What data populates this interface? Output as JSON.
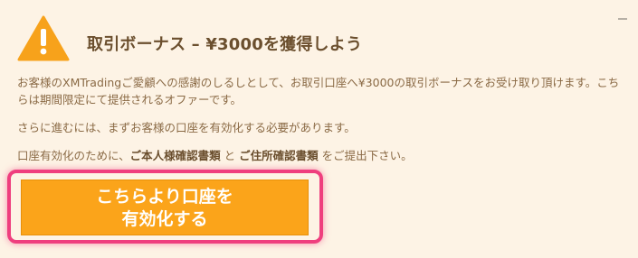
{
  "banner": {
    "title": "取引ボーナス – ¥3000を獲得しよう",
    "icon": "warning-triangle-icon",
    "paragraph1": "お客様のXMTradingご愛顧への感謝のしるしとして、お取引口座へ¥3000の取引ボーナスをお受け取り頂けます。こちらは期間限定にて提供されるオファーです。",
    "paragraph2": "さらに進むには、まずお客様の口座を有効化する必要があります。",
    "paragraph3_prefix": "口座有効化のために、",
    "paragraph3_doc1": "ご本人様確認書類",
    "paragraph3_and": " と ",
    "paragraph3_doc2": "ご住所確認書類",
    "paragraph3_suffix": " をご提出下さい。",
    "cta_line1": "こちらより口座を",
    "cta_line2": "有効化する",
    "minimize_icon": "minimize-icon"
  },
  "colors": {
    "background": "#fdf3e5",
    "warning_triangle": "#f7a21b",
    "cta_button": "#fba41a",
    "cta_highlight": "#ef3e7e",
    "title_text": "#6b4f2e",
    "body_text": "#8a6a45"
  }
}
